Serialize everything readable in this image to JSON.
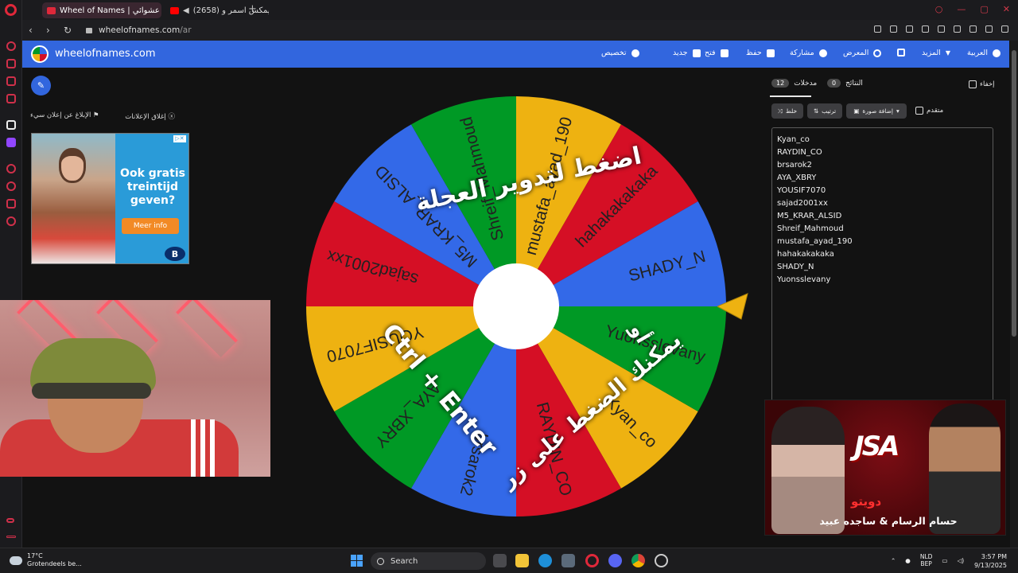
{
  "browser": {
    "tabs": [
      {
        "title": "Wheel of Names | عجلة عشوائي"
      },
      {
        "title": "(2658) ريمكس اسمر و..."
      }
    ],
    "url_domain": "wheelofnames.com",
    "url_path": "/ar"
  },
  "app": {
    "site_name": "wheelofnames.com",
    "nav": {
      "language": "العربية",
      "more": "المزيد",
      "gallery": "المعرض",
      "share": "مشاركة",
      "save": "حفظ",
      "open": "فتح",
      "new": "جديد",
      "customize": "تخصيص"
    }
  },
  "ads": {
    "close_ads": "إغلاق الإعلانات",
    "report_ad": "الإبلاغ عن إعلان سيء",
    "headline": "Ook gratis treintijd geven?",
    "button": "Meer info",
    "brand": "B"
  },
  "wheel": {
    "colors": [
      "#eeb211",
      "#d50f25",
      "#3369e8",
      "#009925"
    ],
    "segments": [
      "Kyan_co",
      "RAYDIN_CO",
      "brsarok2",
      "AYA_XBRY",
      "YOUSIF7070",
      "sajad2001xx",
      "M5_KRAR_ALSID",
      "Shreif_Mahmoud",
      "mustafa_ayad_190",
      "hahakakakaka",
      "SHADY_N",
      "Yuonsslevany"
    ],
    "overlay_main": "اضغط لتدوير العجلة",
    "overlay_or": "أو",
    "overlay_key": "Ctrl + Enter",
    "overlay_hint": "يمكنك الضغط على زر"
  },
  "panel": {
    "entries_tab": "مدخلات",
    "entries_count": "12",
    "results_tab": "النتائج",
    "results_count": "0",
    "hide_label": "إخفاء",
    "shuffle": "خلط",
    "sort": "ترتيب",
    "add_image": "إضافة صورة",
    "advanced": "متقدم",
    "entries": [
      "Kyan_co",
      "RAYDIN_CO",
      "brsarok2",
      "AYA_XBRY",
      "YOUSIF7070",
      "sajad2001xx",
      "M5_KRAR_ALSID",
      "Shreif_Mahmoud",
      "mustafa_ayad_190",
      "hahakakakaka",
      "SHADY_N",
      "Yuonsslevany"
    ]
  },
  "video": {
    "logo": "JSA",
    "red_title": "دويتو",
    "names": "حسام الرسام & ساجده عبيد"
  },
  "taskbar": {
    "temperature": "17°C",
    "weather": "Grotendeels be...",
    "search": "Search",
    "lang1": "NLD",
    "lang2": "BEP",
    "time": "3:57 PM",
    "date": "9/13/2025"
  }
}
